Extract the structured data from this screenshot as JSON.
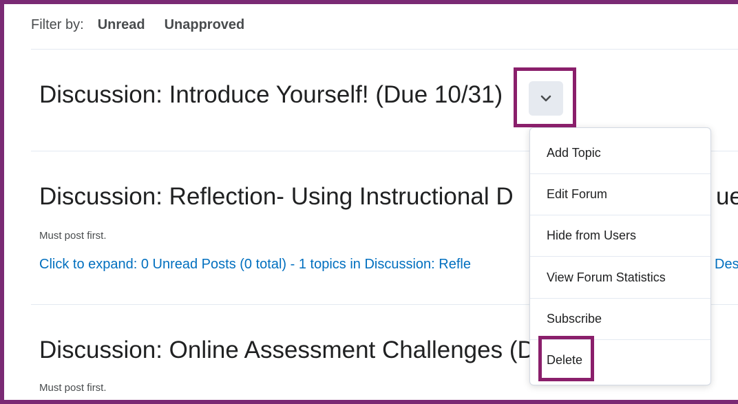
{
  "filter": {
    "label": "Filter by:",
    "unread": "Unread",
    "unapproved": "Unapproved"
  },
  "forums": [
    {
      "title": "Discussion: Introduce Yourself! (Due 10/31)"
    },
    {
      "title": "Discussion: Reflection- Using Instructional D",
      "title_tail": "ue",
      "note": "Must post first.",
      "expand": "Click to expand: 0 Unread Posts (0 total) - 1 topics in Discussion: Refle",
      "expand_tail": "Des"
    },
    {
      "title": "Discussion: Online Assessment Challenges (D",
      "note": "Must post first."
    }
  ],
  "menu": {
    "items": [
      {
        "label": "Add Topic"
      },
      {
        "label": "Edit Forum"
      },
      {
        "label": "Hide from Users"
      },
      {
        "label": "View Forum Statistics"
      },
      {
        "label": "Subscribe"
      },
      {
        "label": "Delete"
      }
    ]
  },
  "colors": {
    "highlight": "#8a1f6b",
    "frame": "#7a2a74",
    "link": "#006fbf"
  }
}
